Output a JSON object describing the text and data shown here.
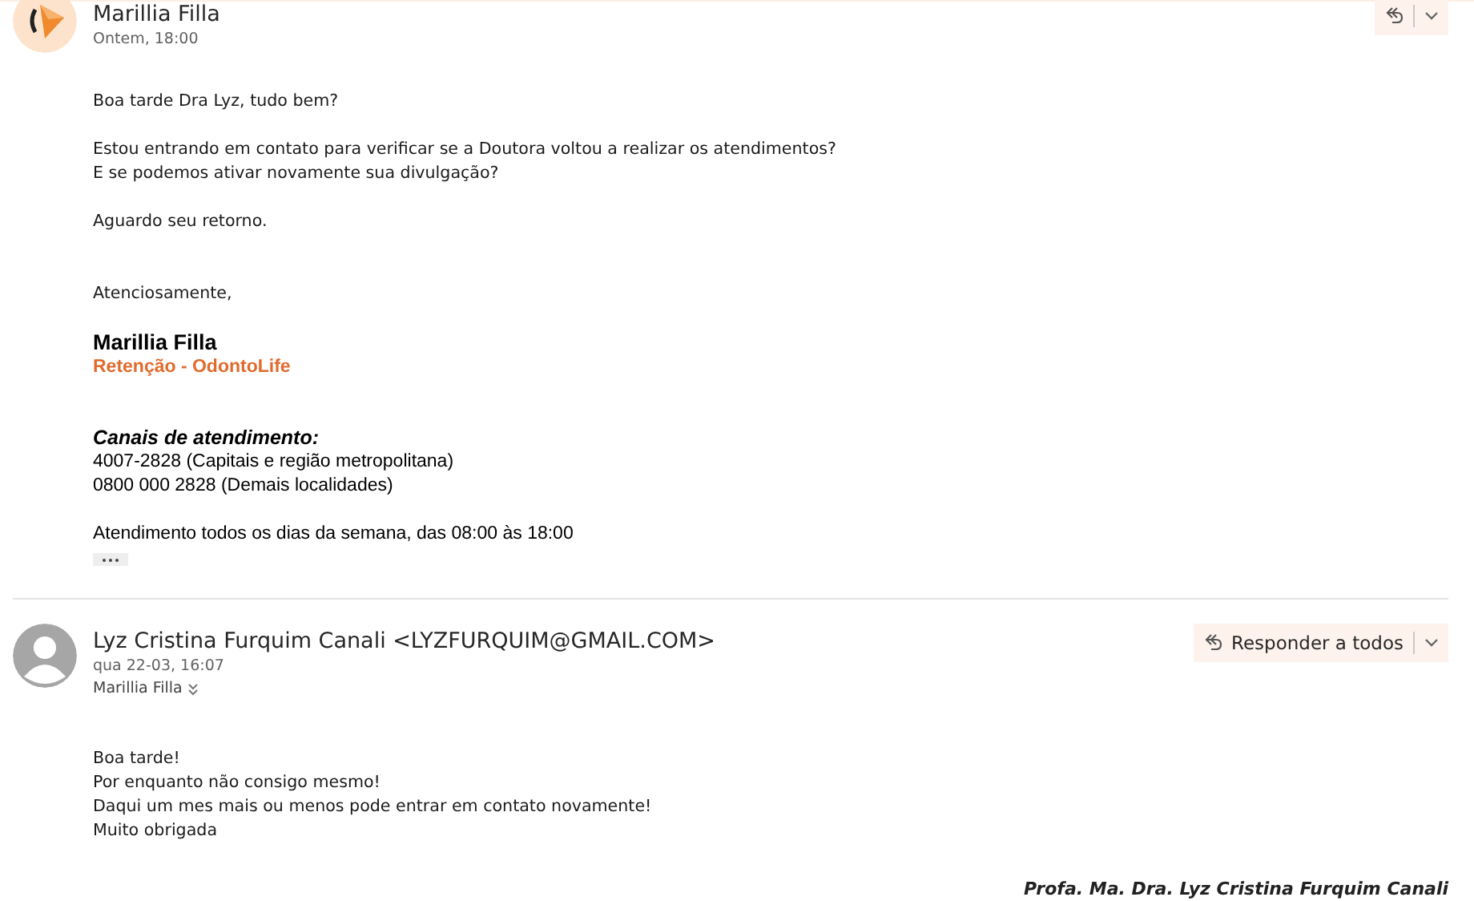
{
  "messages": [
    {
      "sender": "Marillia Filla",
      "date": "Ontem, 18:00",
      "avatar": {
        "kind": "logo"
      },
      "actions": {
        "kind": "compact"
      },
      "paragraphs": [
        [
          "Boa tarde Dra Lyz, tudo bem?"
        ],
        [
          "Estou entrando em contato para verificar se a Doutora voltou a realizar os atendimentos?",
          "E se podemos ativar novamente sua divulgação?"
        ],
        [
          "Aguardo seu retorno."
        ]
      ],
      "signature": {
        "closing": "Atenciosamente,",
        "name": "Marillia Filla",
        "role": "Retenção - OdontoLife",
        "channels_title": "Canais de atendimento:",
        "channels": [
          "4007-2828 (Capitais e região metropolitana)",
          "0800 000 2828 (Demais localidades)"
        ],
        "hours": "Atendimento todos os dias da semana, das 08:00 às 18:00"
      },
      "collapsed_quote": true
    },
    {
      "sender": "Lyz Cristina Furquim Canali <LYZFURQUIM@GMAIL.COM>",
      "date": "qua 22-03, 16:07",
      "recipient": "Marillia Filla",
      "avatar": {
        "kind": "person"
      },
      "actions": {
        "kind": "full",
        "label": "Responder a todos"
      },
      "paragraphs": [
        [
          "Boa tarde!",
          "Por enquanto não consigo mesmo!",
          "Daqui um mes mais ou menos pode entrar em contato novamente!",
          "Muito obrigada"
        ]
      ],
      "signoff": "Profa. Ma. Dra. Lyz Cristina Furquim Canali"
    }
  ]
}
